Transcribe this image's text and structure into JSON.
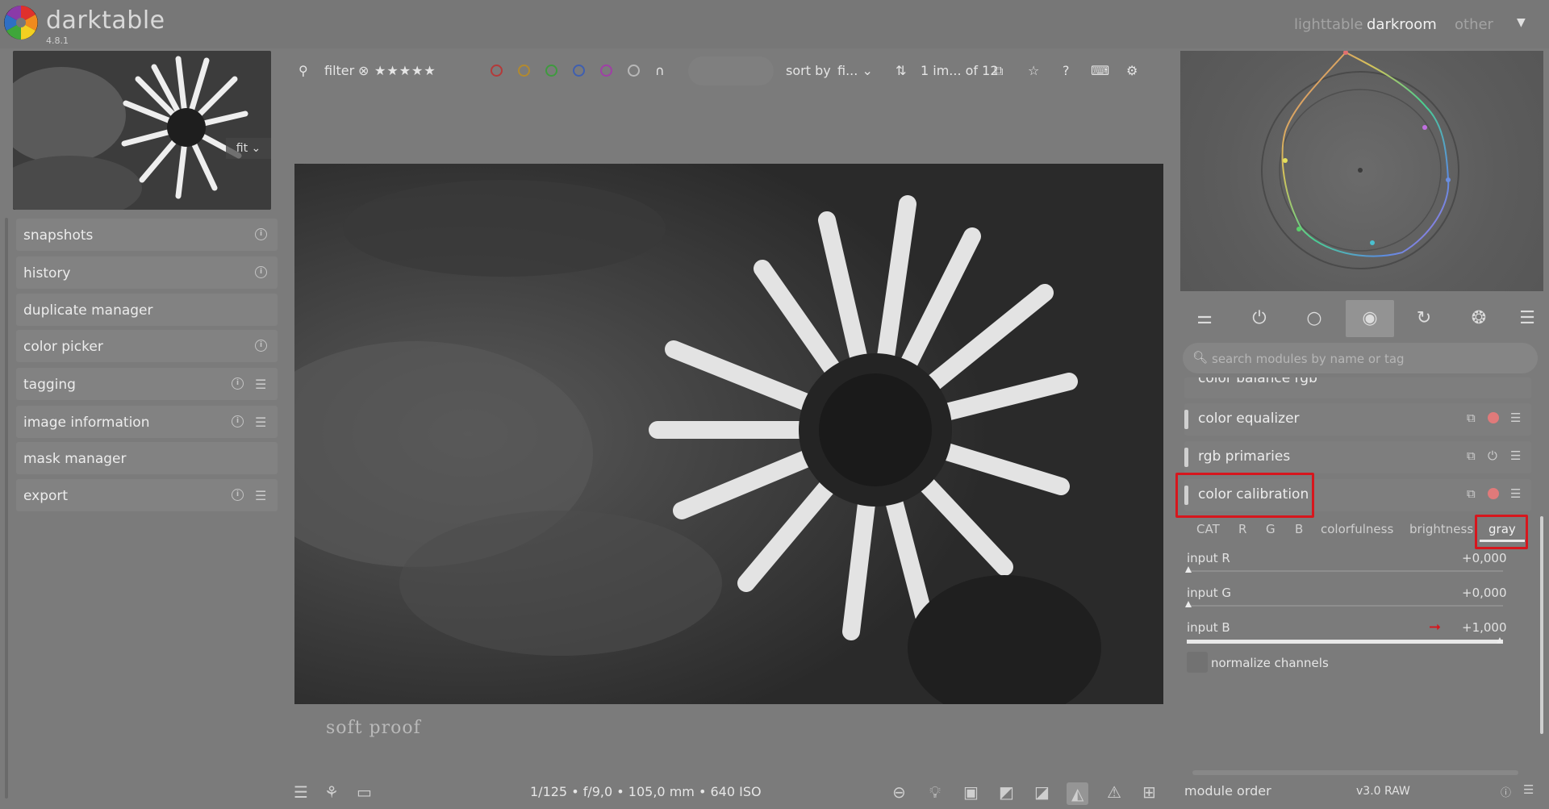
{
  "app": {
    "name": "darktable",
    "version": "4.8.1"
  },
  "views": [
    "lighttable",
    "darkroom",
    "other"
  ],
  "view_menu_icon": "▼",
  "left_panel": {
    "thumbnail_zoom": "fit",
    "modules": [
      {
        "label": "snapshots",
        "info": true,
        "menu": false
      },
      {
        "label": "history",
        "info": true,
        "menu": false
      },
      {
        "label": "duplicate manager",
        "info": false,
        "menu": false
      },
      {
        "label": "color picker",
        "info": true,
        "menu": false
      },
      {
        "label": "tagging",
        "info": true,
        "menu": true
      },
      {
        "label": "image information",
        "info": true,
        "menu": true
      },
      {
        "label": "mask manager",
        "info": false,
        "menu": false
      },
      {
        "label": "export",
        "info": true,
        "menu": true
      }
    ]
  },
  "toolbar": {
    "filter_label": "filter",
    "rating_stars": "★★★★★",
    "color_labels": [
      "#b43a3a",
      "#b28a2f",
      "#3f9a3f",
      "#3f5fb0",
      "#a03fa6"
    ],
    "sort_label": "sort by",
    "sort_value": "fi...",
    "count_text": "1 im... of 12"
  },
  "center": {
    "softproof_label": "soft proof",
    "exif": "1/125 • f/9,0 • 105,0 mm • 640 ISO"
  },
  "right_panel": {
    "module_search_placeholder": "search modules by name or tag",
    "modules": [
      {
        "label": "color balance rgb"
      },
      {
        "label": "color equalizer"
      },
      {
        "label": "rgb primaries"
      },
      {
        "label": "color calibration"
      }
    ],
    "tabs": [
      "CAT",
      "R",
      "G",
      "B",
      "colorfulness",
      "brightness",
      "gray"
    ],
    "active_tab": "gray",
    "params": [
      {
        "label": "input R",
        "value": "+0,000",
        "level": 0
      },
      {
        "label": "input G",
        "value": "+0,000",
        "level": 0
      },
      {
        "label": "input B",
        "value": "+1,000",
        "level": 1
      }
    ],
    "normalize_label": "normalize channels",
    "module_order_label": "module order",
    "module_order_value": "v3.0 RAW"
  },
  "colors": {
    "highlight": "#d7161d",
    "accent_power": "#e07a7a"
  }
}
